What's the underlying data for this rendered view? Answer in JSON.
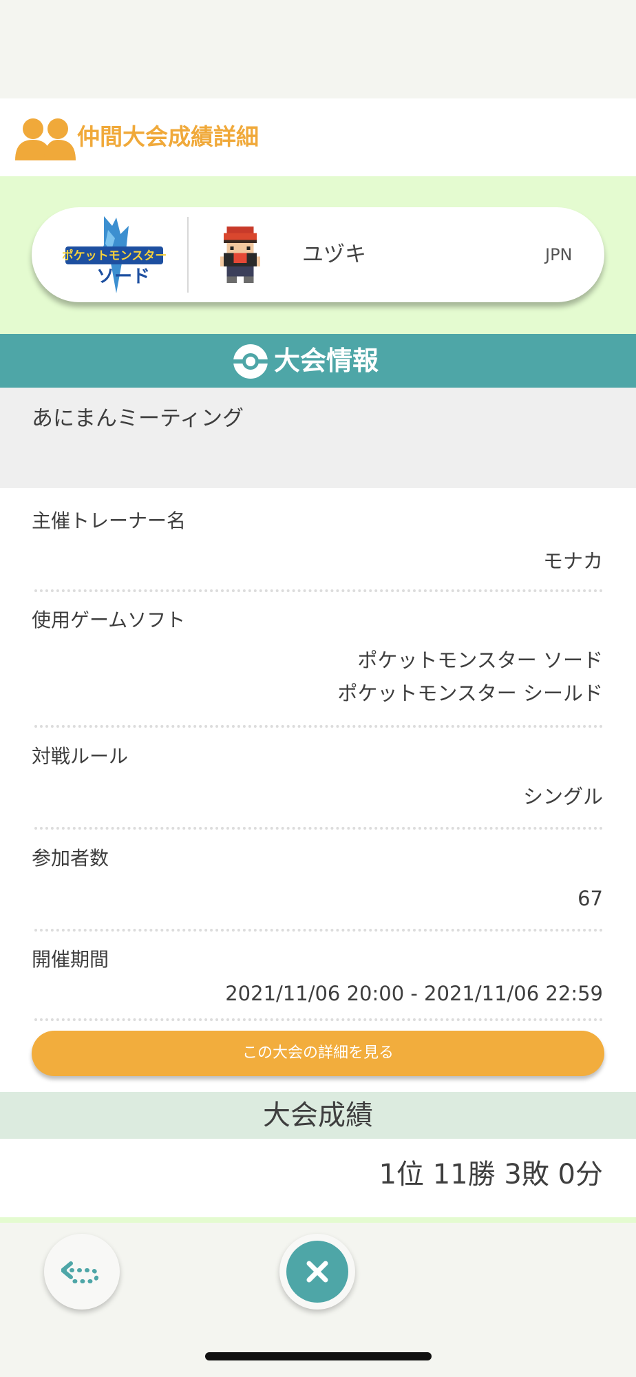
{
  "header": {
    "title": "仲間大会成績詳細",
    "accent_color": "#f0a93a",
    "icon": "people-icon"
  },
  "profile": {
    "game_logo_text": "ポケットモンスター ソード",
    "trainer_name": "ユヅキ",
    "region": "JPN"
  },
  "tournament_info": {
    "section_title": "大会情報",
    "section_color": "#4ea6a7",
    "name": "あにまんミーティング",
    "fields": [
      {
        "label": "主催トレーナー名",
        "values": [
          "モナカ"
        ]
      },
      {
        "label": "使用ゲームソフト",
        "values": [
          "ポケットモンスター ソード",
          "ポケットモンスター シールド"
        ]
      },
      {
        "label": "対戦ルール",
        "values": [
          "シングル"
        ]
      },
      {
        "label": "参加者数",
        "values": [
          "67"
        ]
      },
      {
        "label": "開催期間",
        "values": [
          "2021/11/06 20:00 - 2021/11/06 22:59"
        ]
      }
    ],
    "detail_button_label": "この大会の詳細を見る"
  },
  "results": {
    "title": "大会成績",
    "value": "1位 11勝 3敗 0分"
  },
  "nav": {
    "back_icon": "return-arrow-icon",
    "close_icon": "close-icon"
  }
}
